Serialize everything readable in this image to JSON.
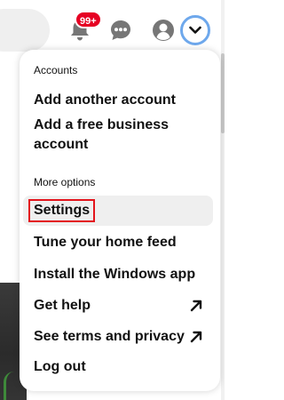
{
  "header": {
    "notification_badge": "99+",
    "icons": [
      "search-field",
      "bell-icon",
      "chat-icon",
      "user-avatar-icon",
      "chevron-down-icon"
    ]
  },
  "menu": {
    "accounts_label": "Accounts",
    "add_account": "Add another account",
    "add_business_line1": "Add a free business",
    "add_business_line2": "account",
    "more_options_label": "More options",
    "settings": "Settings",
    "tune_feed": "Tune your home feed",
    "install_app": "Install the Windows app",
    "get_help": "Get help",
    "terms": "See terms and privacy",
    "log_out": "Log out"
  },
  "colors": {
    "badge": "#e60023",
    "focus_ring": "#6ea8ec",
    "highlight_border": "#e3141c",
    "hover_bg": "#efefef"
  }
}
